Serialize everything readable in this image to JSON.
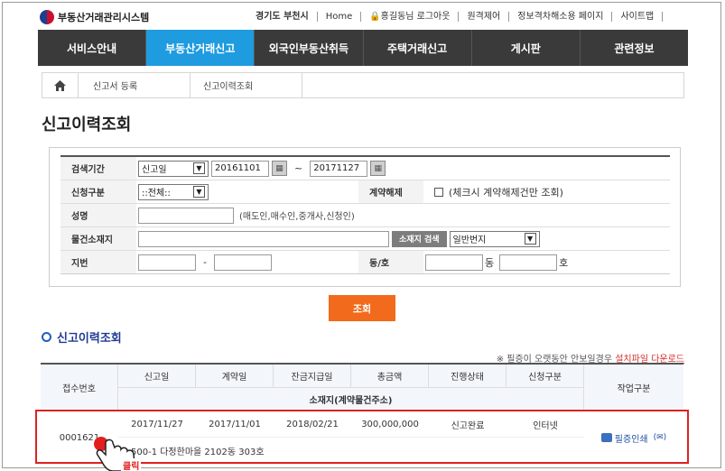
{
  "header": {
    "logo_text": "부동산거래관리시스템",
    "util_links": [
      "경기도 부천시",
      "Home",
      "홍길동님 로그아웃",
      "원격제어",
      "정보격차해소용 페이지",
      "사이트맵"
    ]
  },
  "nav": {
    "items": [
      "서비스안내",
      "부동산거래신고",
      "외국인부동산취득",
      "주택거래신고",
      "게시판",
      "관련정보"
    ],
    "active_index": 1
  },
  "breadcrumb": [
    "신고서 등록",
    "신고이력조회"
  ],
  "page_title": "신고이력조회",
  "form": {
    "period_label": "검색기간",
    "period_type": "신고일",
    "date_from": "20161101",
    "date_sep": "~",
    "date_to": "20171127",
    "apply_type_label": "신청구분",
    "apply_type_value": "::전체::",
    "cancel_label": "계약해제",
    "cancel_hint": "(체크시 계약해제건만 조회)",
    "name_label": "성명",
    "name_value": "",
    "name_hint": "(매도인,매수인,중개사,신청인)",
    "location_label": "물건소재지",
    "location_value": "",
    "location_search_button": "소재지 검색",
    "lot_type": "일반번지",
    "jibun_label": "지번",
    "jibun_main": "",
    "jibun_sep": "-",
    "jibun_sub": "",
    "dongho_label": "동/호",
    "dong_value": "",
    "dong_unit": "동",
    "ho_value": "",
    "ho_unit": "호"
  },
  "search_button": "조회",
  "results": {
    "title": "신고이력조회",
    "notice_prefix": "※ 필증이 오랫동안 안보일경우",
    "notice_link": "설치파일 다운로드",
    "headers": {
      "receipt_no": "접수번호",
      "report_date": "신고일",
      "contract_date": "계약일",
      "balance_date": "잔금지급일",
      "total_amount": "총금액",
      "status": "진행상태",
      "apply_type": "신청구분",
      "address": "소재지(계약물건주소)",
      "action": "작업구분"
    },
    "rows": [
      {
        "receipt_no": "0001621",
        "report_date": "2017/11/27",
        "contract_date": "2017/11/01",
        "balance_date": "2018/02/21",
        "total_amount": "300,000,000",
        "status": "신고완료",
        "apply_type": "인터넷",
        "address": "500-1 다정한마을 2102동 303호",
        "action": "필증인쇄"
      }
    ]
  },
  "annotation": {
    "click_label": "클릭"
  }
}
